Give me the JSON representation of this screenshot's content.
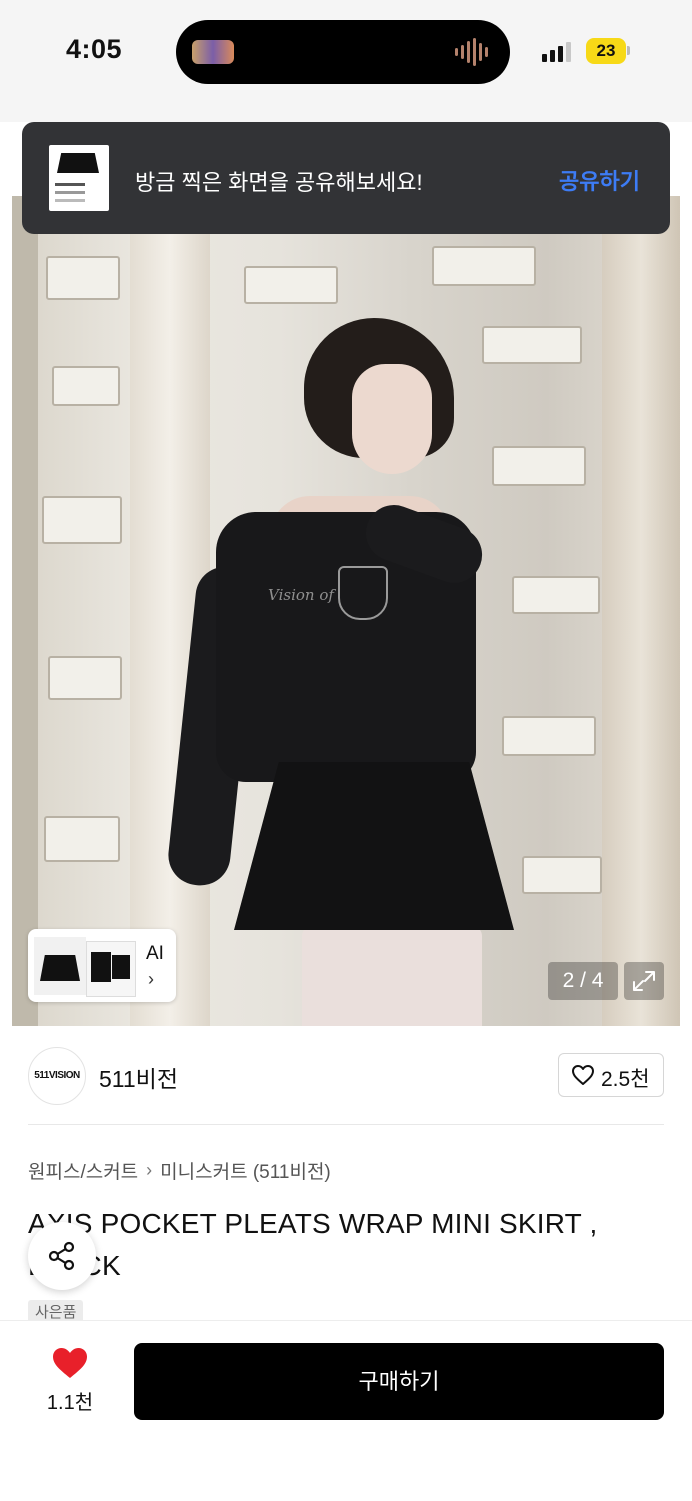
{
  "status_bar": {
    "time": "4:05",
    "battery": "23"
  },
  "toast": {
    "message": "방금 찍은 화면을 공유해보세요!",
    "action_label": "공유하기"
  },
  "gallery": {
    "ai_label": "AI",
    "page_indicator": "2 / 4"
  },
  "brand": {
    "logo_text": "511VISION",
    "name": "511비전",
    "likes": "2.5천"
  },
  "product": {
    "category": "원피스/스커트",
    "subcategory": "미니스커트 (511비전)",
    "title": "AXIS POCKET PLEATS WRAP MINI SKIRT , BLACK",
    "badge": "사은품"
  },
  "bottom_bar": {
    "wishlist_count": "1.1천",
    "buy_label": "구매하기"
  },
  "colors": {
    "accent_blue": "#3d7cf5",
    "heart_red": "#e8202a",
    "battery_yellow": "#f7d917"
  }
}
